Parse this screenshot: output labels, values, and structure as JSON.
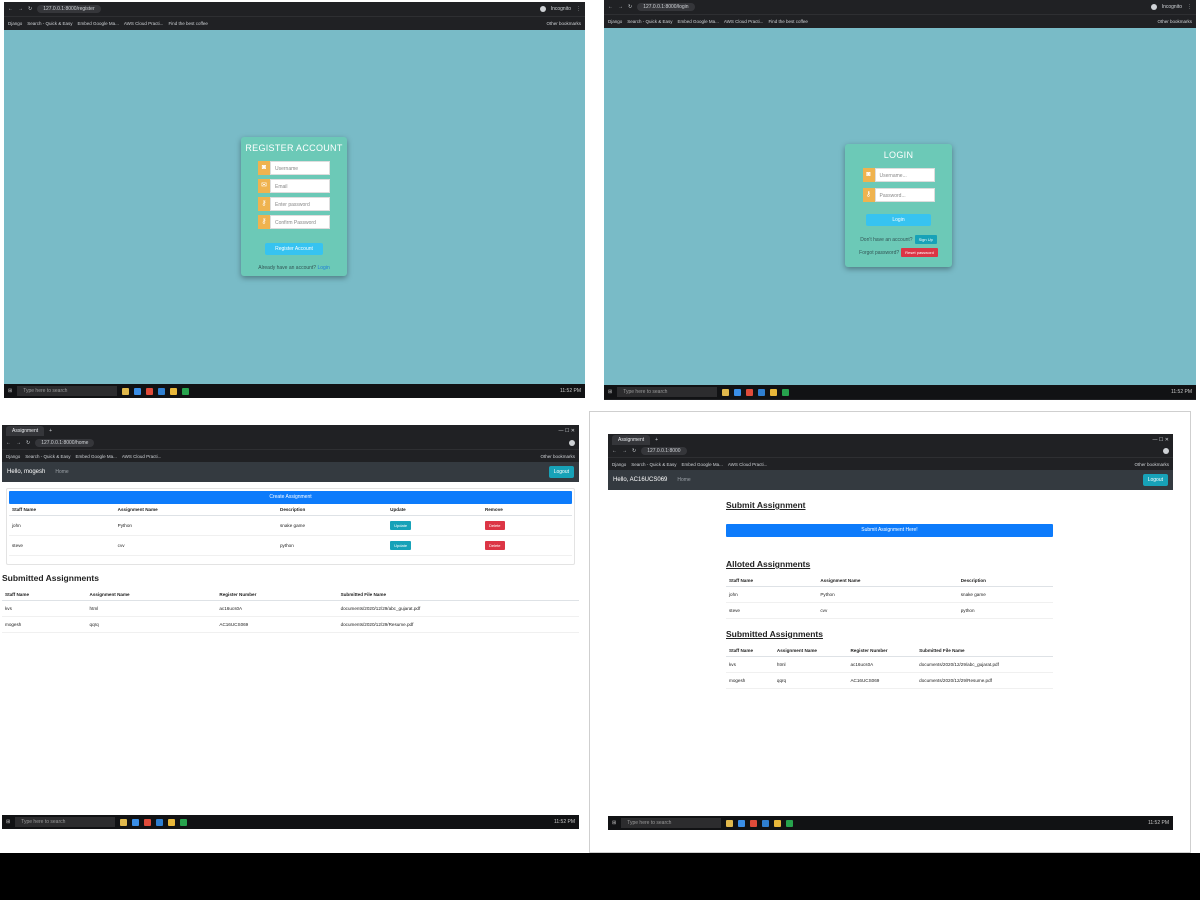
{
  "register_panel": {
    "tab_url": "127.0.0.1:8000/register",
    "bookmarks": [
      "Django",
      "Search - Quick & Easy",
      "Embed Google Ma...",
      "AWS Cloud Practi...",
      "Find the best coffee"
    ],
    "other_bookmarks": "Other bookmarks",
    "profile": "Incognito",
    "card_title": "REGISTER ACCOUNT",
    "fields": [
      "Username",
      "Email",
      "Enter password",
      "Confirm Password"
    ],
    "submit": "Register Account",
    "footer_text": "Already have an account?",
    "footer_link": "Login"
  },
  "login_panel": {
    "tab_url": "127.0.0.1:8000/login",
    "bookmarks": [
      "Django",
      "Search - Quick & Easy",
      "Embed Google Ma...",
      "AWS Cloud Practi...",
      "Find the best coffee"
    ],
    "other_bookmarks": "Other bookmarks",
    "profile": "Incognito",
    "card_title": "LOGIN",
    "fields": [
      "Username...",
      "Password..."
    ],
    "submit": "Login",
    "signup_text": "Don't have an account?",
    "signup_btn": "Sign Up",
    "forgot_text": "Forgot password?",
    "forgot_btn": "Reset password"
  },
  "staff_panel": {
    "tab_title": "Assignment",
    "tab_url": "127.0.0.1:8000/home",
    "greeting": "Hello, mogesh",
    "nav_home": "Home",
    "logout": "Logout",
    "create_btn": "Create Assignment",
    "headers": [
      "Staff Name",
      "Assignment Name",
      "Description",
      "Update",
      "Remove"
    ],
    "rows": [
      [
        "john",
        "Python",
        "snake game",
        "Update",
        "Delete"
      ],
      [
        "steve",
        "cvv",
        "python",
        "Update",
        "Delete"
      ]
    ],
    "submitted_title": "Submitted Assignments",
    "sub_headers": [
      "Staff Name",
      "Assignment Name",
      "Register Number",
      "Submitted File Name"
    ],
    "sub_rows": [
      [
        "kvs",
        "html",
        "ac16ucs0A",
        "documents/2020/12/29/abc_gujarat.pdf"
      ],
      [
        "mogesh",
        "qqrq",
        "AC16UCS069",
        "documents/2020/12/29/Resume.pdf"
      ]
    ]
  },
  "student_panel": {
    "tab_title": "Assignment",
    "tab_url": "127.0.0.1:8000",
    "greeting": "Hello, AC16UCS069",
    "nav_home": "Home",
    "logout": "Logout",
    "submit_title": "Submit Assignment",
    "submit_btn": "Submit Assignment Here!",
    "alloted_title": "Alloted Assignments",
    "alloted_headers": [
      "Staff Name",
      "Assignment Name",
      "Description"
    ],
    "alloted_rows": [
      [
        "john",
        "Python",
        "snake game"
      ],
      [
        "steve",
        "cvv",
        "python"
      ]
    ],
    "submitted_title": "Submitted Assignments",
    "sub_headers": [
      "Staff Name",
      "Assignment Name",
      "Register Number",
      "Submitted File Name"
    ],
    "sub_rows": [
      [
        "kvs",
        "html",
        "ac16ucs0A",
        "documents/2020/12/29/abc_gujarat.pdf"
      ],
      [
        "mogesh",
        "qqrq",
        "AC16UCS069",
        "documents/2020/12/29/Resume.pdf"
      ]
    ]
  },
  "taskbar": {
    "search": "Type here to search",
    "time": "11:52 PM",
    "date": "12/29/2020"
  },
  "colors": {
    "page_teal": "#79bbc7",
    "card_green": "#6cc9b7",
    "primary_blue": "#0d7bfb",
    "info": "#17a2b8",
    "danger": "#dc3545"
  }
}
